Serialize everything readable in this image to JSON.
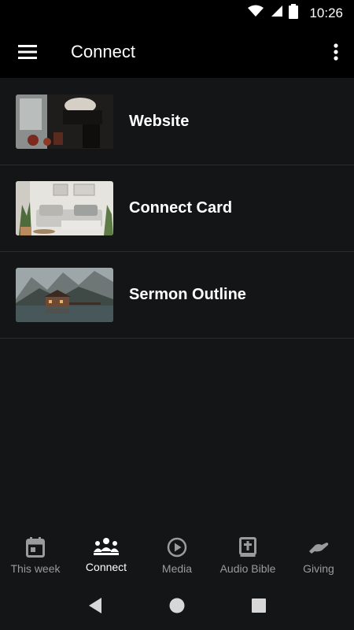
{
  "status_bar": {
    "time": "10:26"
  },
  "app_bar": {
    "title": "Connect"
  },
  "list": [
    {
      "label": "Website"
    },
    {
      "label": "Connect Card"
    },
    {
      "label": "Sermon Outline"
    }
  ],
  "bottom_nav": [
    {
      "label": "This week",
      "icon": "calendar-icon",
      "active": false
    },
    {
      "label": "Connect",
      "icon": "people-icon",
      "active": true
    },
    {
      "label": "Media",
      "icon": "play-circle-icon",
      "active": false
    },
    {
      "label": "Audio Bible",
      "icon": "bible-icon",
      "active": false
    },
    {
      "label": "Giving",
      "icon": "giving-hand-icon",
      "active": false
    }
  ],
  "colors": {
    "background": "#141517",
    "bar": "#000000",
    "inactive": "#9a9b9d",
    "active": "#ffffff"
  }
}
